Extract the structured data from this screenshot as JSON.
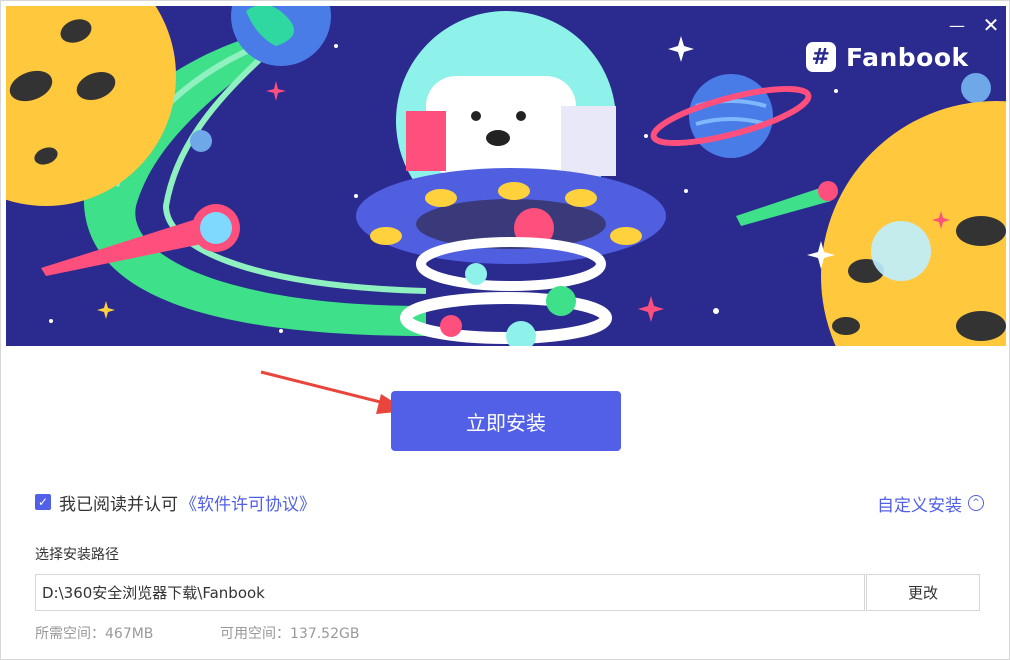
{
  "window": {
    "minimize_glyph": "—",
    "close_glyph": "✕"
  },
  "banner": {
    "logo_icon_glyph": "#",
    "logo_text": "Fanbook",
    "colors": {
      "bg": "#2a2a8f",
      "accent": "#5160e6"
    }
  },
  "install": {
    "button_label": "立即安装"
  },
  "agreement": {
    "checked": true,
    "check_glyph": "✓",
    "prefix": "我已阅读并认可",
    "link_label": "《软件许可协议》"
  },
  "custom_install": {
    "label": "自定义安装",
    "icon_glyph": "^"
  },
  "path": {
    "label": "选择安装路径",
    "value": "D:\\360安全浏览器下载\\Fanbook",
    "change_label": "更改"
  },
  "space": {
    "required": "所需空间：467MB",
    "available": "可用空间：137.52GB"
  }
}
